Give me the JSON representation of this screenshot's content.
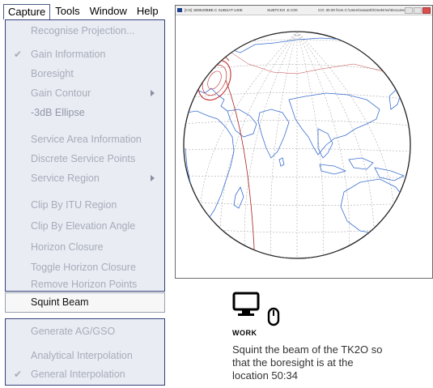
{
  "menubar": {
    "items": [
      "Capture",
      "Tools",
      "Window",
      "Help"
    ],
    "active": "Capture"
  },
  "capture_menu": {
    "items": [
      {
        "label": "Recognise Projection..."
      },
      {
        "label": "Gain Information",
        "checked": "✔"
      },
      {
        "label": "Boresight"
      },
      {
        "label": "Gain Contour",
        "submenu": true
      },
      {
        "label": "-3dB Ellipse",
        "highlighted": true
      },
      {
        "label": "Service Area Information"
      },
      {
        "label": "Discrete Service Points"
      },
      {
        "label": "Service Region",
        "submenu": true
      },
      {
        "label": "Clip By ITU Region"
      },
      {
        "label": "Clip By Elevation Angle"
      },
      {
        "label": "Horizon Closure"
      },
      {
        "label": "Toggle Horizon Closure"
      },
      {
        "label": "Remove Horizon Points"
      }
    ],
    "squint_beam": "Squint Beam",
    "lower_items": [
      {
        "label": "Generate AG/GSO"
      },
      {
        "label": "Analytical Interpolation"
      },
      {
        "label": "General Interpolation",
        "checked": "✔"
      }
    ]
  },
  "map_window": {
    "title_left": "[CO] 1B9520BBE.C SUBSAT-140E",
    "title_mid": "SUBTCKO  .E.C00",
    "title_right": "CO: 30.00 from C:\\Users\\vasanth\\OneDrive\\Documen...",
    "colors": {
      "coast": "#3a6fd0",
      "grid": "#9a9a9a",
      "ellipse": "#c03030"
    }
  },
  "work": {
    "label": "WORK",
    "lines": [
      "Squint the beam of the TK2O so",
      "that the boresight is at the",
      "location 50:34"
    ]
  }
}
